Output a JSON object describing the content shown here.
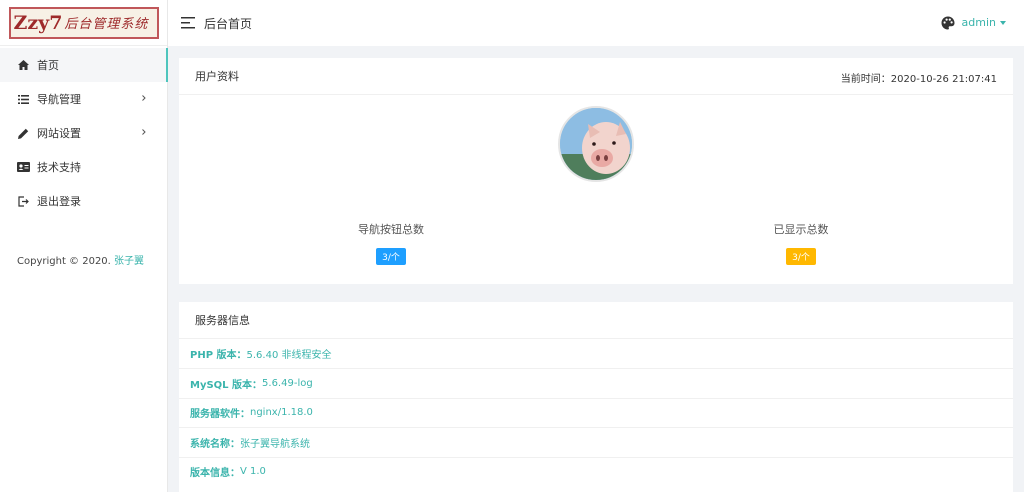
{
  "logo": {
    "main": "Zzy7",
    "sub": "后台管理系统"
  },
  "sidebar": {
    "items": [
      {
        "label": "首页",
        "icon": "home-icon"
      },
      {
        "label": "导航管理",
        "icon": "list-icon"
      },
      {
        "label": "网站设置",
        "icon": "pencil-icon"
      },
      {
        "label": "技术支持",
        "icon": "id-card-icon"
      },
      {
        "label": "退出登录",
        "icon": "logout-icon"
      }
    ],
    "copyright": {
      "text": "Copyright © 2020. ",
      "author": "张子翼"
    }
  },
  "header": {
    "title": "后台首页",
    "user": "admin"
  },
  "profile_card": {
    "title": "用户资料",
    "time_label": "当前时间：",
    "time_value": "2020-10-26 21:07:41",
    "stats": [
      {
        "label": "导航按钮总数",
        "badge": "3/个",
        "color": "#1e9fff"
      },
      {
        "label": "已显示总数",
        "badge": "3/个",
        "color": "#ffb800"
      }
    ]
  },
  "server_card": {
    "title": "服务器信息",
    "rows": [
      {
        "key": "PHP 版本：",
        "value": "5.6.40 非线程安全"
      },
      {
        "key": "MySQL 版本：",
        "value": "5.6.49-log"
      },
      {
        "key": "服务器软件：",
        "value": "nginx/1.18.0"
      },
      {
        "key": "系统名称：",
        "value": "张子翼导航系统"
      },
      {
        "key": "版本信息：",
        "value": "V 1.0"
      }
    ]
  },
  "colors": {
    "accent": "#3bb4ac",
    "badge_blue": "#1e9fff",
    "badge_orange": "#ffb800"
  }
}
